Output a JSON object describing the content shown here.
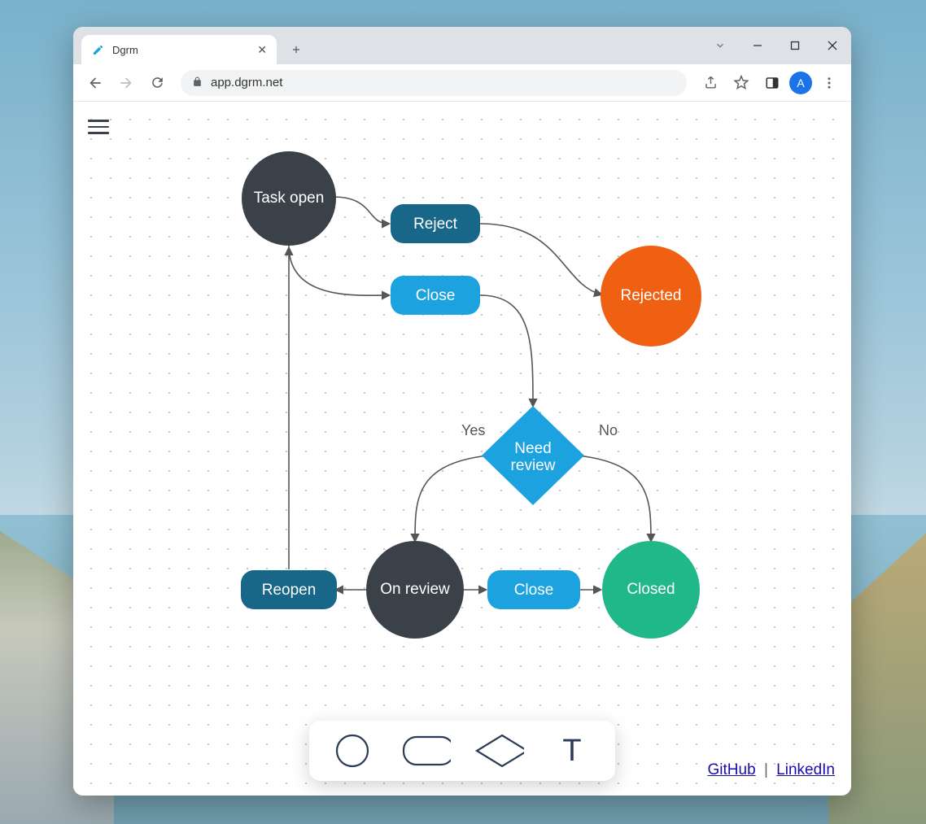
{
  "browser": {
    "tab_title": "Dgrm",
    "url": "app.dgrm.net",
    "avatar_letter": "A"
  },
  "flowchart": {
    "nodes": {
      "task_open": "Task open",
      "reject": "Reject",
      "close1": "Close",
      "rejected": "Rejected",
      "need_review_l1": "Need",
      "need_review_l2": "review",
      "reopen": "Reopen",
      "on_review": "On review",
      "close2": "Close",
      "closed": "Closed"
    },
    "labels": {
      "yes": "Yes",
      "no": "No"
    },
    "colors": {
      "dark": "#3A4149",
      "teal": "#186789",
      "sky": "#1DA2E0",
      "orange": "#F06013",
      "green": "#20B789"
    }
  },
  "palette": {
    "circle": "circle",
    "rounded_rect": "rounded-rect",
    "rhombus": "rhombus",
    "text": "T"
  },
  "footer": {
    "github": "GitHub",
    "linkedin": "LinkedIn",
    "sep": "|"
  }
}
